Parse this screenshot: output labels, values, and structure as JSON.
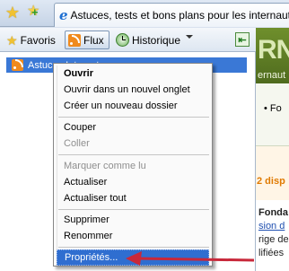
{
  "tabstrip": {
    "favorites_icon": "star-icon",
    "add_favorite_icon": "add-favorite-icon",
    "tab_title": "Astuces, tests et bons plans pour les internautes",
    "colors": {
      "star": "#f1c232"
    }
  },
  "favorites_center": {
    "favoris_label": "Favoris",
    "flux_label": "Flux",
    "historique_label": "Historique",
    "pin_icon": "pin-to-left-icon"
  },
  "feeds": {
    "items": [
      {
        "label": "Astuces Internet",
        "icon": "rss-feed-icon",
        "selected": true
      }
    ]
  },
  "context_menu": {
    "items": [
      {
        "label": "Ouvrir",
        "bold": true,
        "enabled": true
      },
      {
        "label": "Ouvrir dans un nouvel onglet",
        "enabled": true
      },
      {
        "label": "Créer un nouveau dossier",
        "enabled": true
      },
      {
        "label": "Couper",
        "enabled": true
      },
      {
        "label": "Coller",
        "enabled": false
      },
      {
        "label": "Marquer comme lu",
        "enabled": false
      },
      {
        "label": "Actualiser",
        "enabled": true
      },
      {
        "label": "Actualiser tout",
        "enabled": true
      },
      {
        "label": "Supprimer",
        "enabled": true
      },
      {
        "label": "Renommer",
        "enabled": true
      },
      {
        "label": "Propriétés...",
        "enabled": true,
        "highlighted": true
      }
    ]
  },
  "webpage": {
    "logo": "RN",
    "logo_sub": "ernaut",
    "nav_item": "• Fo",
    "headline": "2 disp",
    "line1": "Fonda",
    "line2": "sion d",
    "line3": "rige de",
    "line4": "lifiées",
    "brand_color": "#5b7a24",
    "accent_color": "#e07a00"
  },
  "annotation": {
    "arrow_color": "#c8283a",
    "target": "Propriétés..."
  }
}
